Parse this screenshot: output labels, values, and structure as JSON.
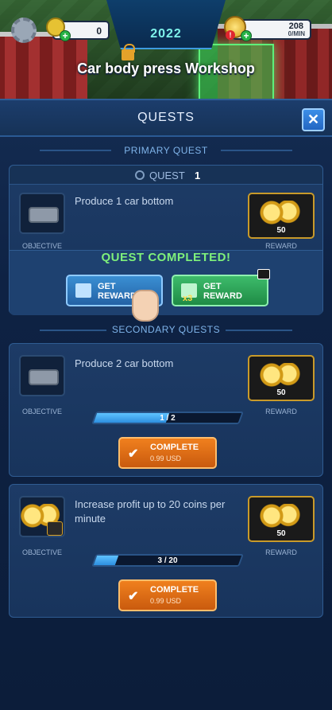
{
  "hud": {
    "keys_count": "0",
    "coins_count": "208",
    "coins_unit": "0/MIN",
    "alert_count": "!",
    "year": "2022",
    "workshop_title": "Car body press Workshop"
  },
  "quests_panel": {
    "title": "QUESTS",
    "close_label": "✕",
    "primary_section_label": "PRIMARY QUEST",
    "secondary_section_label": "SECONDARY QUESTS"
  },
  "primary_quest": {
    "quest_label": "QUEST",
    "quest_number": "1",
    "description": "Produce 1 car bottom",
    "objective_label": "OBJECTIVE",
    "reward_label": "REWARD",
    "reward_amount": "50",
    "completed_text": "QUEST COMPLETED!",
    "get_reward_label_1": "GET",
    "get_reward_label_2": "REWARD",
    "get_reward_x3_label_1": "GET",
    "get_reward_x3_label_2": "REWARD",
    "multiplier": "x3"
  },
  "secondary_quests": [
    {
      "description": "Produce 2 car bottom",
      "objective_label": "OBJECTIVE",
      "reward_label": "REWARD",
      "reward_amount": "50",
      "progress_text": "1 / 2",
      "progress_fraction": 0.5,
      "complete_label": "COMPLETE",
      "price": "0.99 USD"
    },
    {
      "description": "Increase profit up to 20 coins per minute",
      "objective_label": "OBJECTIVE",
      "reward_label": "REWARD",
      "reward_amount": "50",
      "progress_text": "3 / 20",
      "progress_fraction": 0.15,
      "complete_label": "COMPLETE",
      "price": "0.99 USD"
    }
  ],
  "colors": {
    "panel_bg": "#0e2244",
    "accent_blue": "#3d8fe8",
    "completed_green": "#7ef07b",
    "complete_orange": "#f0801e",
    "reward_gold": "#c89a2a"
  },
  "icons": [
    "gear-icon",
    "key-icon",
    "coin-icon",
    "lock-icon",
    "close-icon",
    "quest-icon",
    "car-bottom-icon",
    "coin-stack-icon",
    "gift-icon",
    "video-icon",
    "hand-pointer-icon",
    "check-icon",
    "gauge-icon"
  ]
}
